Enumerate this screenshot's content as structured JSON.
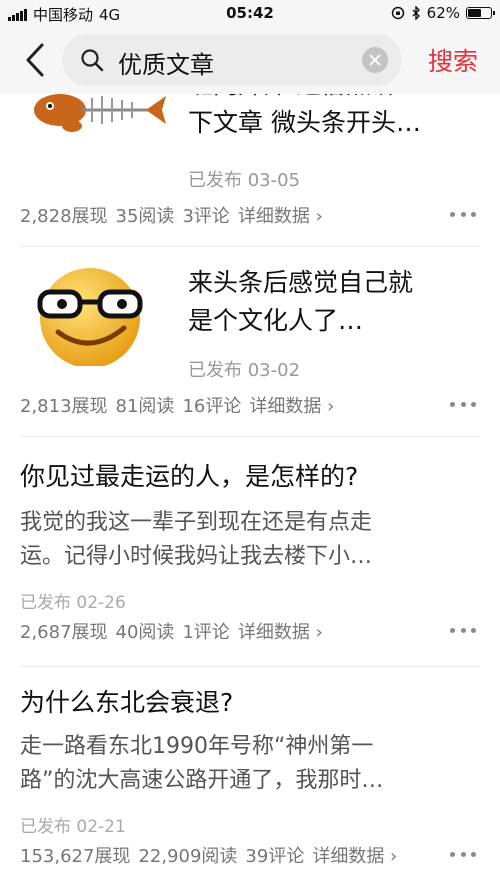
{
  "status_bar": {
    "carrier": "中国移动",
    "network": "4G",
    "time": "05:42",
    "battery_text": "62%",
    "battery_level_percent": 62
  },
  "search": {
    "back_icon": "chevron-left-icon",
    "query": "优质文章",
    "action_label": "搜索",
    "action_color": "#e8303a"
  },
  "articles": [
    {
      "title_lines": [
        "班门弄斧 通俗点讲一",
        "下文章 微头条开头…"
      ],
      "published": "已发布  03-05",
      "stats": {
        "views": "2,828展现",
        "reads": "35阅读",
        "comments": "3评论",
        "detail": "详细数据 ›"
      },
      "thumbnail": "fish-skeleton-cat-image"
    },
    {
      "title_lines": [
        "来头条后感觉自己就",
        "是个文化人了…"
      ],
      "published": "已发布  03-02",
      "stats": {
        "views": "2,813展现",
        "reads": "81阅读",
        "comments": "16评论",
        "detail": "详细数据 ›"
      },
      "thumbnail": "glasses-smiley-face-image"
    },
    {
      "title": "你见过最走运的人，是怎样的?",
      "excerpt_lines": [
        "我觉的我这一辈子到现在还是有点走",
        "运。记得小时候我妈让我去楼下小…"
      ],
      "published": "已发布  02-26",
      "stats": {
        "views": "2,687展现",
        "reads": "40阅读",
        "comments": "1评论",
        "detail": "详细数据 ›"
      }
    },
    {
      "title": "为什么东北会衰退?",
      "excerpt_lines": [
        "走一路看东北1990年号称“神州第一",
        "路”的沈大高速公路开通了，我那时…"
      ],
      "published": "已发布  02-21",
      "stats": {
        "views": "153,627展现",
        "reads": "22,909阅读",
        "comments": "39评论",
        "detail": "详细数据 ›"
      }
    }
  ]
}
